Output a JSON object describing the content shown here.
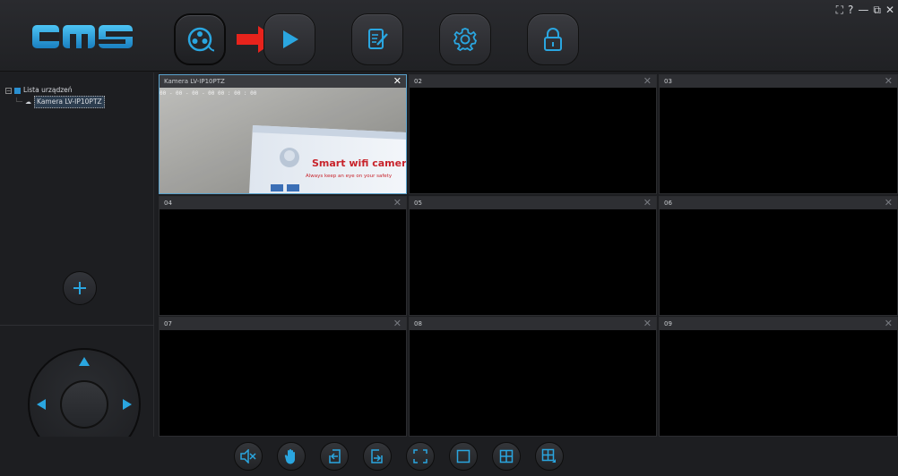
{
  "app": {
    "logo_text": "cms"
  },
  "header": {
    "nav": [
      {
        "name": "reel",
        "label": ""
      },
      {
        "name": "play",
        "label": ""
      },
      {
        "name": "edit",
        "label": ""
      },
      {
        "name": "settings",
        "label": ""
      },
      {
        "name": "lock",
        "label": ""
      }
    ],
    "window_controls": {
      "help": "?",
      "minimize": "—",
      "restore": "⧉",
      "close": "✕"
    }
  },
  "sidebar": {
    "tree_root": "Lista urządzeń",
    "tree_items": [
      "Kamera LV-IP10PTZ"
    ]
  },
  "cells": [
    {
      "title": "Kamera LV-IP10PTZ",
      "active": true
    },
    {
      "title": "02"
    },
    {
      "title": "03"
    },
    {
      "title": "04"
    },
    {
      "title": "05"
    },
    {
      "title": "06"
    },
    {
      "title": "07"
    },
    {
      "title": "08"
    },
    {
      "title": "09"
    }
  ],
  "video": {
    "box_text": "Smart wifi camera",
    "box_sub": "Always keep an eye on your safety"
  },
  "toolbar": [
    "mute-icon",
    "hand-icon",
    "export-left-icon",
    "export-right-icon",
    "fullscreen-icon",
    "layout-1-icon",
    "layout-4-icon",
    "layout-custom-icon"
  ],
  "colors": {
    "accent": "#2aa6e0",
    "red_arrow": "#e8231c",
    "active_border": "#5aa2cc"
  }
}
